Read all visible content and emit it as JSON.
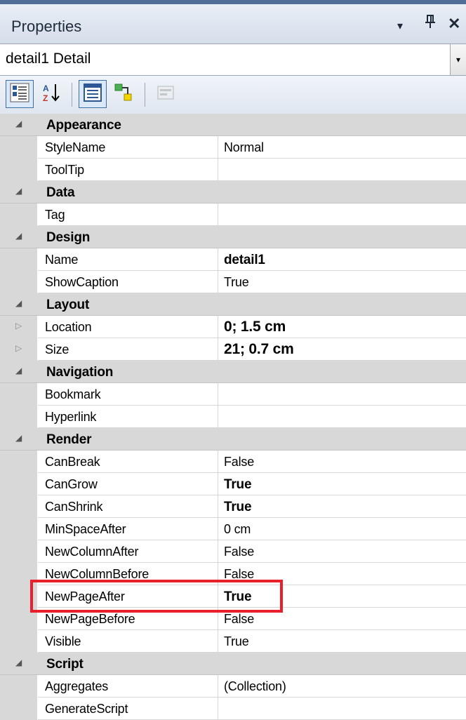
{
  "window": {
    "title": "Properties",
    "dropdown_glyph": "▾",
    "pin_glyph": "ᚹ",
    "close_glyph": "✕"
  },
  "object_selector": {
    "value": "detail1 Detail",
    "arrow": "▾"
  },
  "toolbar": {
    "buttons": [
      "categorized-icon",
      "alphabetical-icon",
      "properties-icon",
      "events-icon",
      "property-pages-icon"
    ],
    "alphabetical_label": "A Z"
  },
  "categories": [
    {
      "name": "Appearance",
      "expander": "◢",
      "properties": [
        {
          "name": "StyleName",
          "value": "Normal"
        },
        {
          "name": "ToolTip",
          "value": ""
        }
      ]
    },
    {
      "name": "Data",
      "expander": "◢",
      "properties": [
        {
          "name": "Tag",
          "value": ""
        }
      ]
    },
    {
      "name": "Design",
      "expander": "◢",
      "properties": [
        {
          "name": "Name",
          "value": "detail1"
        },
        {
          "name": "ShowCaption",
          "value": "True"
        }
      ]
    },
    {
      "name": "Layout",
      "expander": "◢",
      "properties": [
        {
          "name": "Location",
          "value": "0; 1.5 cm",
          "expander": "▷"
        },
        {
          "name": "Size",
          "value": "21; 0.7 cm",
          "expander": "▷"
        }
      ]
    },
    {
      "name": "Navigation",
      "expander": "◢",
      "properties": [
        {
          "name": "Bookmark",
          "value": ""
        },
        {
          "name": "Hyperlink",
          "value": ""
        }
      ]
    },
    {
      "name": "Render",
      "expander": "◢",
      "properties": [
        {
          "name": "CanBreak",
          "value": "False"
        },
        {
          "name": "CanGrow",
          "value": "True"
        },
        {
          "name": "CanShrink",
          "value": "True"
        },
        {
          "name": "MinSpaceAfter",
          "value": "0 cm"
        },
        {
          "name": "NewColumnAfter",
          "value": "False"
        },
        {
          "name": "NewColumnBefore",
          "value": "False"
        },
        {
          "name": "NewPageAfter",
          "value": "True"
        },
        {
          "name": "NewPageBefore",
          "value": "False"
        },
        {
          "name": "Visible",
          "value": "True"
        }
      ]
    },
    {
      "name": "Script",
      "expander": "◢",
      "properties": [
        {
          "name": "Aggregates",
          "value": "(Collection)"
        },
        {
          "name": "GenerateScript",
          "value": ""
        }
      ]
    }
  ],
  "highlight_color": "#e8202a"
}
